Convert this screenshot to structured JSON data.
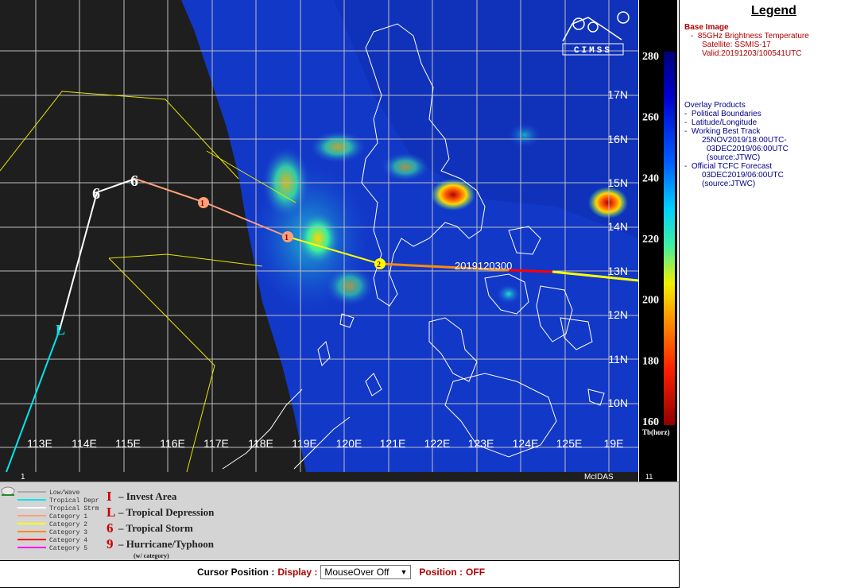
{
  "map": {
    "lon_labels": [
      "113E",
      "114E",
      "115E",
      "116E",
      "117E",
      "118E",
      "119E",
      "120E",
      "121E",
      "122E",
      "123E",
      "124E",
      "125E",
      "19E"
    ],
    "lat_labels": [
      "17N",
      "16N",
      "15N",
      "14N",
      "13N",
      "12N",
      "11N",
      "10N"
    ],
    "track_label": "2019120300",
    "corner_left": "1",
    "corner_right": "McIDAS",
    "logo_text": "CIMSS",
    "track_symbols": [
      "6",
      "6",
      "1",
      "1",
      "2",
      "L"
    ]
  },
  "scale": {
    "ticks": [
      "280",
      "260",
      "240",
      "220",
      "200",
      "180",
      "160"
    ],
    "ticks_values": [
      280,
      260,
      240,
      220,
      200,
      180,
      160
    ],
    "unit": "Tb(horz)",
    "corner": "11"
  },
  "legend": {
    "title": "Legend",
    "base_image_header": "Base Image",
    "base_product": "85GHz Brightness Temperature",
    "satellite": "Satellite: SSMIS-17",
    "valid": "Valid:20191203/100541UTC",
    "overlay_header": "Overlay Products",
    "political": "Political Boundaries",
    "latlon": "Latitude/Longitude",
    "best_track": "Working Best Track",
    "best_track_from": "25NOV2019/18:00UTC-",
    "best_track_to": "03DEC2019/06:00UTC",
    "best_track_source": "(source:JTWC)",
    "forecast": "Official TCFC Forecast",
    "forecast_time": "03DEC2019/06:00UTC",
    "forecast_source": "(source:JTWC)"
  },
  "key": {
    "lines": [
      {
        "label": "Low/Wave",
        "color": "#aaaaaa"
      },
      {
        "label": "Tropical Depr",
        "color": "#00e5ee"
      },
      {
        "label": "Tropical Strm",
        "color": "#ffffff"
      },
      {
        "label": "Category 1",
        "color": "#ffa07a"
      },
      {
        "label": "Category 2",
        "color": "#ffff00"
      },
      {
        "label": "Category 3",
        "color": "#ff8c00"
      },
      {
        "label": "Category 4",
        "color": "#ff0000"
      },
      {
        "label": "Category 5",
        "color": "#ff00ff"
      }
    ],
    "symbols": [
      {
        "glyph": "I",
        "label": "– Invest Area"
      },
      {
        "glyph": "L",
        "label": "– Tropical Depression"
      },
      {
        "glyph": "6",
        "label": "– Tropical Storm"
      },
      {
        "glyph": "9",
        "label": "– Hurricane/Typhoon"
      }
    ],
    "category_note": "(w/ category)"
  },
  "cursor": {
    "label": "Cursor Position :",
    "display_label": "Display :",
    "select_value": "MouseOver Off",
    "position_label": "Position :",
    "position_value": "OFF"
  },
  "colors": {
    "map_bg": "#1e1e1e",
    "legend_red": "#b00000",
    "legend_blue": "#00008b"
  }
}
